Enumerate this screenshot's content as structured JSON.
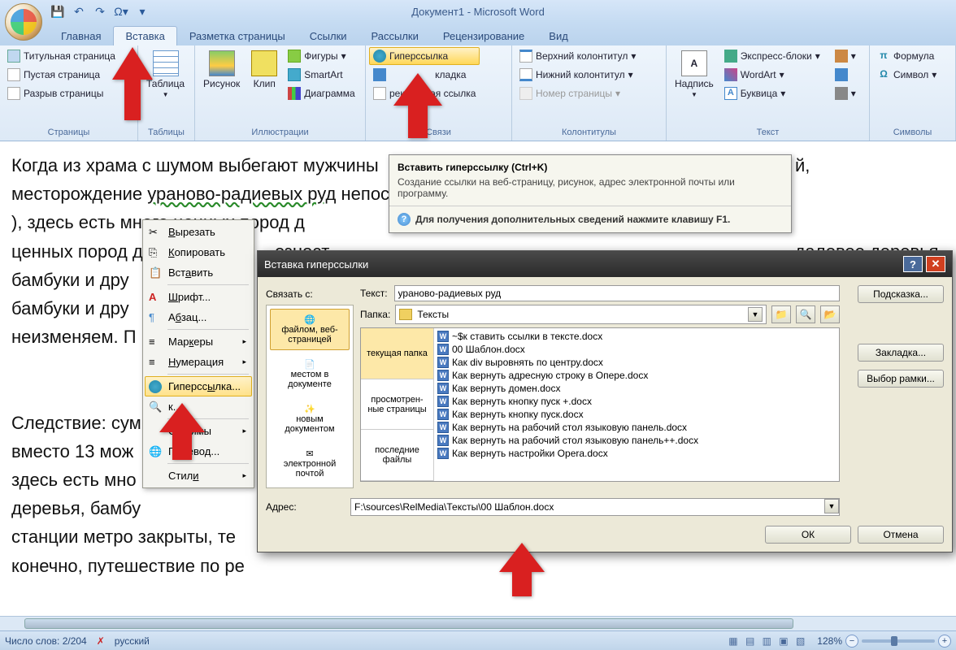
{
  "title": "Документ1 - Microsoft Word",
  "tabs": [
    "Главная",
    "Вставка",
    "Разметка страницы",
    "Ссылки",
    "Рассылки",
    "Рецензирование",
    "Вид"
  ],
  "active_tab": 1,
  "ribbon": {
    "pages": {
      "label": "Страницы",
      "items": [
        "Титульная страница",
        "Пустая страница",
        "Разрыв страницы"
      ]
    },
    "tables": {
      "label": "Таблицы",
      "item": "Таблица"
    },
    "illus": {
      "label": "Иллюстрации",
      "big": [
        "Рисунок",
        "Клип"
      ],
      "small": [
        "Фигуры",
        "SmartArt",
        "Диаграмма"
      ]
    },
    "links": {
      "label": "Связи",
      "items": [
        "Гиперссылка",
        "Закладка",
        "Перекрестная ссылка"
      ]
    },
    "header": {
      "label": "Колонтитулы",
      "items": [
        "Верхний колонтитул",
        "Нижний колонтитул",
        "Номер страницы"
      ]
    },
    "text": {
      "label": "Текст",
      "big": "Надпись",
      "small": [
        "Экспресс-блоки",
        "WordArt",
        "Буквица"
      ]
    },
    "symbols": {
      "label": "Символы",
      "items": [
        "Формула",
        "Символ"
      ]
    }
  },
  "tooltip": {
    "title": "Вставить гиперссылку (Ctrl+K)",
    "body": "Создание ссылки на веб-страницу, рисунок, адрес электронной почты или программу.",
    "help": "Для получения дополнительных сведений нажмите клавишу F1."
  },
  "context": {
    "items": [
      "Вырезать",
      "Копировать",
      "Вставить",
      "Шрифт...",
      "Абзац...",
      "Маркеры",
      "Нумерация",
      "Гиперссылка...",
      "Поиск...",
      "Синонимы",
      "Перевод...",
      "Стили"
    ],
    "hot_index": 7
  },
  "dialog": {
    "title": "Вставка гиперссылки",
    "link_to_label": "Связать с:",
    "text_label": "Текст:",
    "text_value": "ураново-радиевых руд",
    "tip_btn": "Подсказка...",
    "folder_label": "Папка:",
    "folder_value": "Тексты",
    "link_to": [
      "файлом, веб-страницей",
      "местом в документе",
      "новым документом",
      "электронной почтой"
    ],
    "browse_tabs": [
      "текущая папка",
      "просмотрен-ные страницы",
      "последние файлы"
    ],
    "files": [
      "~$к ставить ссылки в тексте.docx",
      "00 Шаблон.docx",
      "Как div выровнять по центру.docx",
      "Как вернуть адресную строку в Опере.docx",
      "Как вернуть домен.docx",
      "Как вернуть кнопку пуск +.docx",
      "Как вернуть кнопку пуск.docx",
      "Как вернуть на рабочий стол языковую панель.docx",
      "Как вернуть на рабочий стол языковую панель++.docx",
      "Как вернуть настройки Opera.docx"
    ],
    "addr_label": "Адрес:",
    "addr_value": "F:\\sources\\RelMedia\\Тексты\\00 Шаблон.docx",
    "bookmark_btn": "Закладка...",
    "frame_btn": "Выбор рамки...",
    "ok": "ОК",
    "cancel": "Отмена"
  },
  "doc_text": {
    "p1a": "Когда из храма с шумом выбегают мужчины",
    "p1b": "й, месторождение ",
    "p1c": "ураново-радиевых руд",
    "p1d": " непосредственно пр",
    "p1e": "), здесь есть много ценных пород д",
    "p1f": "езност",
    "p1g": "даловое деревья, бамбуки и дру",
    "p1h": "неизменяем. П",
    "p2a": "Следствие: сум",
    "p2b": "вместо 13 мож",
    "p2c": "здесь есть мно",
    "p2d": "деревья, бамбу",
    "p2e": "станции метро закрыты, те",
    "p2f": "конечно, путешествие по ре"
  },
  "status": {
    "words": "Число слов: 2/204",
    "lang": "русский",
    "zoom": "128%"
  }
}
